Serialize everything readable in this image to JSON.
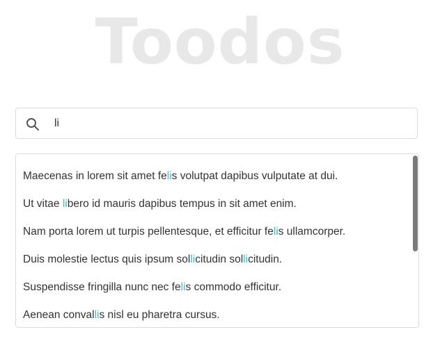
{
  "title": "Toodos",
  "search": {
    "icon": "search-icon",
    "value": "li",
    "highlight_color": "#40b9c8"
  },
  "todos": [
    {
      "before": "Maecenas in lorem sit amet fe",
      "match": "li",
      "after": "s volutpat dapibus vulputate at dui."
    },
    {
      "before": "Ut vitae ",
      "match": "li",
      "after": "bero id mauris dapibus tempus in sit amet enim."
    },
    {
      "before": "Nam porta lorem ut turpis pellentesque, et efficitur fe",
      "match": "li",
      "after": "s ullamcorper."
    },
    {
      "before": "Duis molestie lectus quis ipsum sol",
      "match": "li",
      "after": "citudin sol",
      "match2": "li",
      "after2": "citudin."
    },
    {
      "before": "Suspendisse fringilla nunc nec fe",
      "match": "li",
      "after": "s commodo efficitur."
    },
    {
      "before": "Aenean conval",
      "match": "li",
      "after": "s nisl eu pharetra cursus."
    }
  ]
}
